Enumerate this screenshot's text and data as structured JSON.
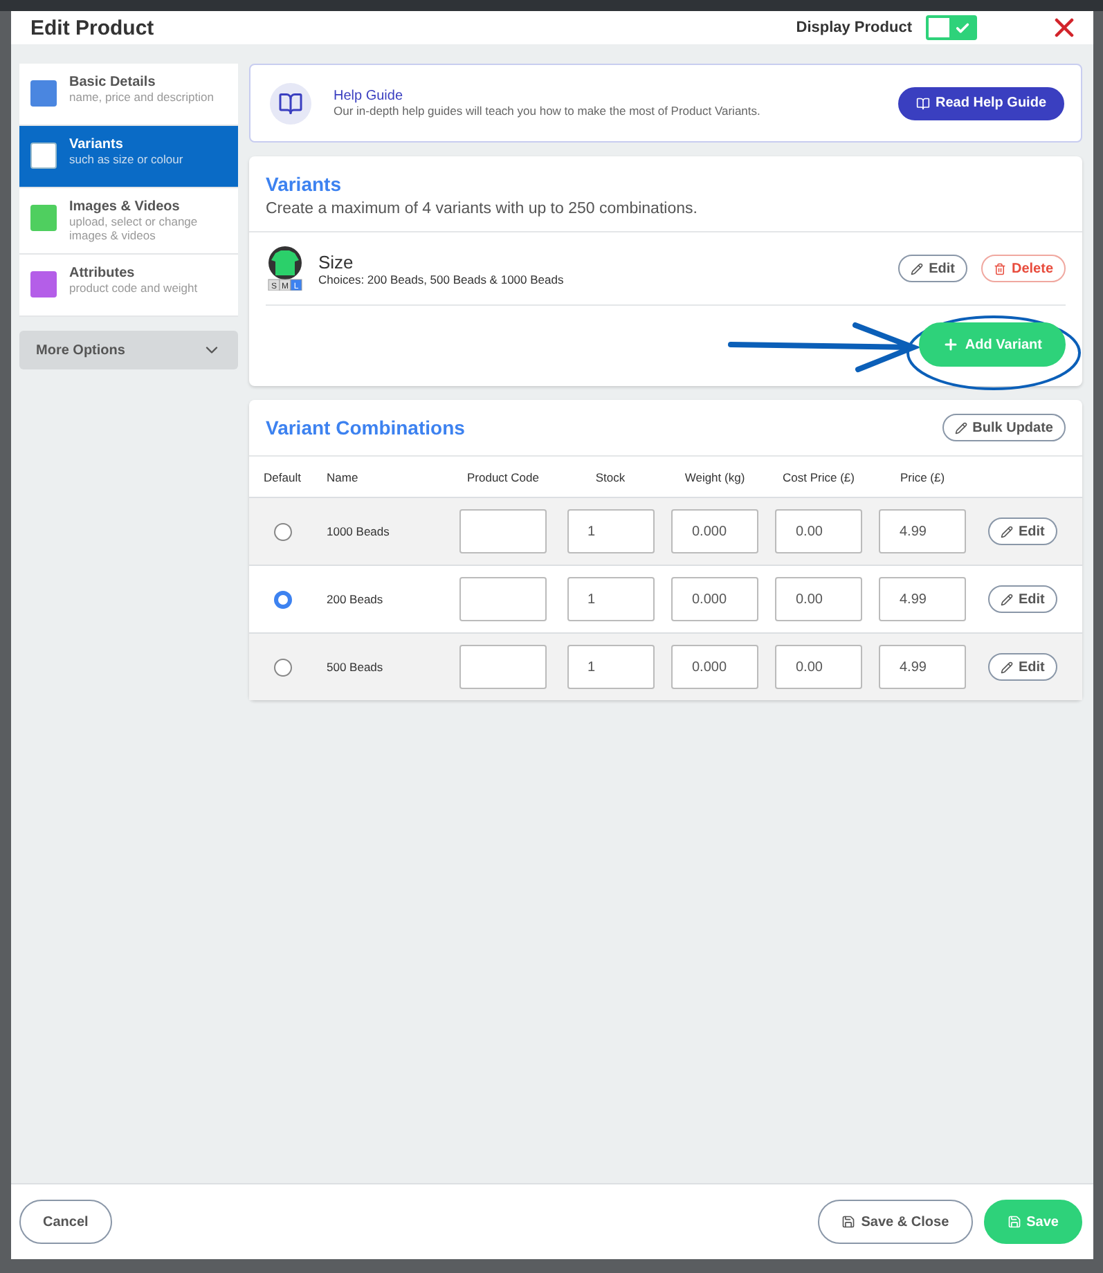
{
  "window": {
    "title": "Edit Product",
    "display_toggle": {
      "label": "Display Product",
      "on": true
    }
  },
  "sidebar": {
    "items": [
      {
        "title": "Basic Details",
        "subtitle": "name, price and description",
        "color": "#4a86e0",
        "selected": false
      },
      {
        "title": "Variants",
        "subtitle": "such as size or colour",
        "color": "#ffffff",
        "selected": true
      },
      {
        "title": "Images & Videos",
        "subtitle": "upload, select or change images & videos",
        "color": "#4fcf5f",
        "selected": false
      },
      {
        "title": "Attributes",
        "subtitle": "product code and weight",
        "color": "#b45ee8",
        "selected": false
      }
    ],
    "more_options": "More Options"
  },
  "help": {
    "title": "Help Guide",
    "text": "Our in-depth help guides will teach you how to make the most of Product Variants.",
    "button": "Read Help Guide"
  },
  "variants": {
    "title": "Variants",
    "description": "Create a maximum of 4 variants with up to 250 combinations.",
    "items": [
      {
        "name": "Size",
        "choices": "Choices: 200 Beads, 500 Beads & 1000 Beads",
        "sizes": [
          "S",
          "M",
          "L"
        ],
        "edit": "Edit",
        "delete": "Delete"
      }
    ],
    "add_button": "Add Variant"
  },
  "combinations": {
    "title": "Variant Combinations",
    "bulk_button": "Bulk Update",
    "columns": [
      "Default",
      "Name",
      "Product Code",
      "Stock",
      "Weight (kg)",
      "Cost Price (£)",
      "Price (£)"
    ],
    "rows": [
      {
        "selected": false,
        "name": "1000 Beads",
        "stock": "1",
        "weight": "0.000",
        "cost": "0.00",
        "price": "4.99",
        "edit": "Edit"
      },
      {
        "selected": true,
        "name": "200 Beads",
        "stock": "1",
        "weight": "0.000",
        "cost": "0.00",
        "price": "4.99",
        "edit": "Edit"
      },
      {
        "selected": false,
        "name": "500 Beads",
        "stock": "1",
        "weight": "0.000",
        "cost": "0.00",
        "price": "4.99",
        "edit": "Edit"
      }
    ]
  },
  "footer": {
    "cancel": "Cancel",
    "save_close": "Save & Close",
    "save": "Save"
  }
}
